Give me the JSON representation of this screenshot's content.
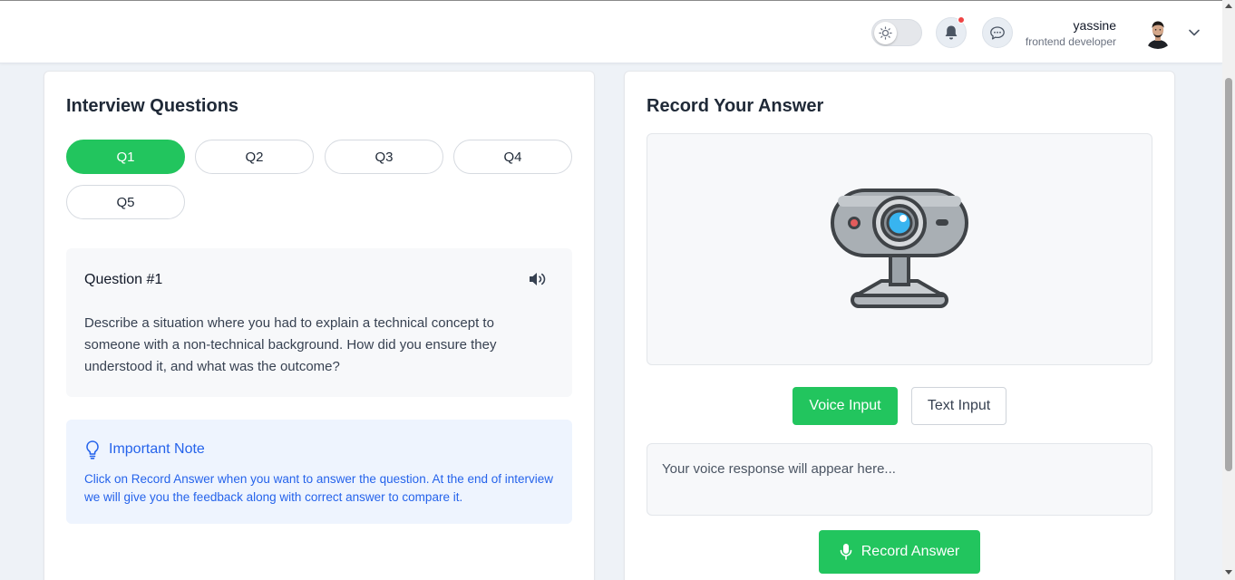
{
  "header": {
    "user_name": "yassine",
    "user_role": "frontend developer",
    "icons": [
      "sun-icon",
      "bell-icon",
      "chat-icon",
      "chevron-down-icon"
    ]
  },
  "questions_panel": {
    "title": "Interview Questions",
    "tabs": [
      "Q1",
      "Q2",
      "Q3",
      "Q4",
      "Q5"
    ],
    "active_tab": "Q1",
    "question": {
      "title": "Question #1",
      "text": "Describe a situation where you had to explain a technical concept to someone with a non-technical background. How did you ensure they understood it, and what was the outcome?"
    },
    "note": {
      "title": "Important Note",
      "text": "Click on Record Answer when you want to answer the question. At the end of interview we will give you the feedback along with correct answer to compare it."
    }
  },
  "answer_panel": {
    "title": "Record Your Answer",
    "voice_input_label": "Voice Input",
    "text_input_label": "Text Input",
    "response_placeholder": "Your voice response will appear here...",
    "record_label": "Record Answer"
  },
  "colors": {
    "accent_green": "#22c55e",
    "note_blue": "#2563eb",
    "note_bg": "#eef4fe",
    "notification_dot": "#ef4444"
  }
}
